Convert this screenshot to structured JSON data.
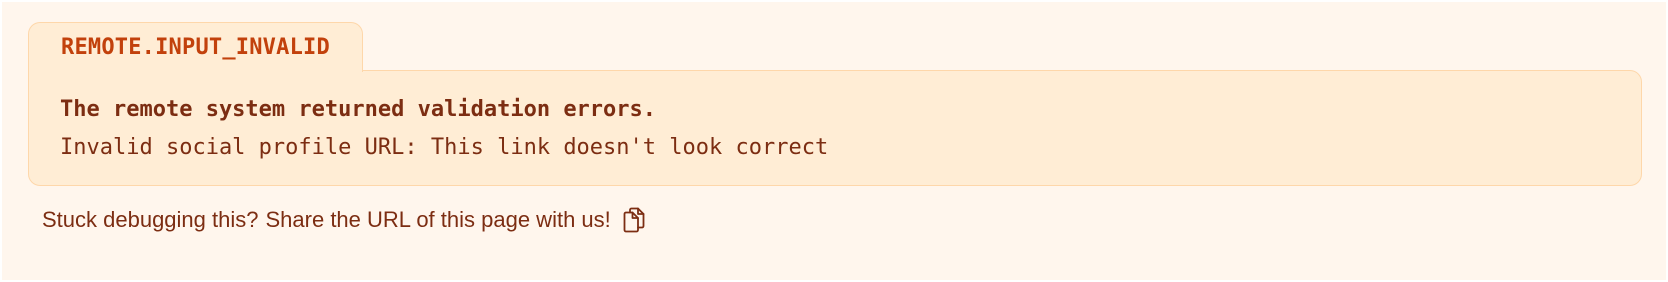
{
  "error": {
    "code": "REMOTE.INPUT_INVALID",
    "title": "The remote system returned validation errors.",
    "detail": "Invalid social profile URL: This link doesn't look correct"
  },
  "footer": {
    "prompt": "Stuck debugging this?",
    "share_text": "Share the URL of this page with us!",
    "copy_icon": "copy-icon"
  },
  "colors": {
    "page_background": "#fff6ed",
    "card_background": "#ffedd5",
    "card_border": "#fed7aa",
    "code_text": "#c2410c",
    "body_text": "#7c2d12"
  }
}
